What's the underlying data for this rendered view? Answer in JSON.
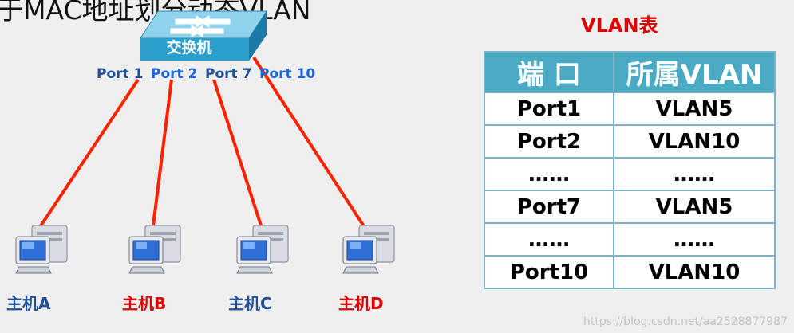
{
  "diagram": {
    "title": "于MAC地址划分动态VLAN",
    "switch_label": "交换机",
    "ports": [
      {
        "label": "Port 1",
        "color": "#1f4f96"
      },
      {
        "label": "Port 2",
        "color": "#1a64e6"
      },
      {
        "label": "Port 7",
        "color": "#1f4f96"
      },
      {
        "label": "Port 10",
        "color": "#1a64e6"
      }
    ],
    "hosts": [
      {
        "label": "主机A",
        "color": "#1f4f96"
      },
      {
        "label": "主机B",
        "color": "#e00000"
      },
      {
        "label": "主机C",
        "color": "#1f4f96"
      },
      {
        "label": "主机D",
        "color": "#e00000"
      }
    ],
    "link_color": "#ff2200"
  },
  "vlan_table": {
    "title": "VLAN表",
    "headers": [
      "端 口",
      "所属VLAN"
    ],
    "rows": [
      [
        "Port1",
        "VLAN5"
      ],
      [
        "Port2",
        "VLAN10"
      ],
      [
        "……",
        "……"
      ],
      [
        "Port7",
        "VLAN5"
      ],
      [
        "……",
        "……"
      ],
      [
        "Port10",
        "VLAN10"
      ]
    ]
  },
  "watermark": "https://blog.csdn.net/aa2528877987"
}
